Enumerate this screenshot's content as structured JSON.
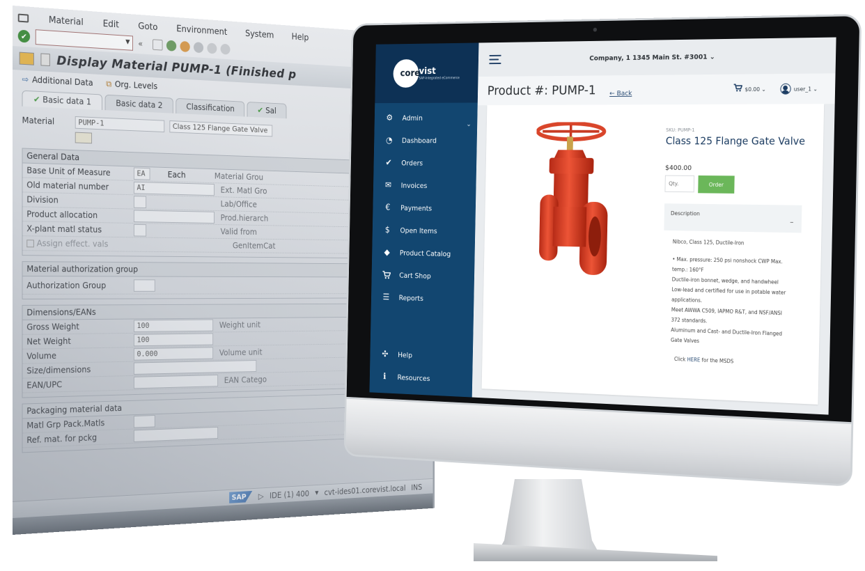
{
  "sap": {
    "menu": [
      "Material",
      "Edit",
      "Goto",
      "Environment",
      "System",
      "Help"
    ],
    "command_field": "",
    "title": "Display Material PUMP-1 (Finished p",
    "app_toolbar": [
      "Additional Data",
      "Org. Levels"
    ],
    "tabs": [
      "Basic data 1",
      "Basic data 2",
      "Classification",
      "Sal"
    ],
    "material_label": "Material",
    "material_value": "PUMP-1",
    "material_description": "Class 125 Flange Gate Valve",
    "general_data": {
      "title": "General Data",
      "rows": [
        {
          "label": "Base Unit of Measure",
          "value": "EA",
          "extra": "Each",
          "side": "Material Grou"
        },
        {
          "label": "Old material number",
          "value": "AI",
          "extra": "",
          "side": "Ext. Matl Gro"
        },
        {
          "label": "Division",
          "value": "",
          "extra": "",
          "side": "Lab/Office"
        },
        {
          "label": "Product allocation",
          "value": "",
          "extra": "",
          "side": "Prod.hierarch"
        },
        {
          "label": "X-plant matl status",
          "value": "",
          "extra": "",
          "side": "Valid from"
        },
        {
          "label": "Assign effect. vals",
          "value": "",
          "extra": "",
          "side": "GenItemCat"
        }
      ]
    },
    "auth_group": {
      "title": "Material authorization group",
      "rows": [
        {
          "label": "Authorization Group",
          "value": ""
        }
      ]
    },
    "dimensions": {
      "title": "Dimensions/EANs",
      "rows": [
        {
          "label": "Gross Weight",
          "value": "100",
          "side": "Weight unit"
        },
        {
          "label": "Net Weight",
          "value": "100",
          "side": ""
        },
        {
          "label": "Volume",
          "value": "0.000",
          "side": "Volume unit"
        },
        {
          "label": "Size/dimensions",
          "value": "",
          "side": ""
        },
        {
          "label": "EAN/UPC",
          "value": "",
          "side": "EAN Catego"
        }
      ]
    },
    "packaging": {
      "title": "Packaging material data",
      "rows": [
        {
          "label": "Matl Grp Pack.Matls",
          "value": ""
        },
        {
          "label": "Ref. mat. for pckg",
          "value": ""
        }
      ]
    },
    "status": {
      "logo": "SAP",
      "system": "IDE (1) 400",
      "server": "cvt-ides01.corevist.local",
      "mode": "INS"
    }
  },
  "app": {
    "logo": {
      "brand": "corevist",
      "tagline": "SAP-Integrated eCommerce"
    },
    "nav": [
      {
        "label": "Admin",
        "icon": "gear-icon",
        "glyph": "⚙"
      },
      {
        "label": "Dashboard",
        "icon": "pie-chart-icon",
        "glyph": "◔"
      },
      {
        "label": "Orders",
        "icon": "clipboard-check-icon",
        "glyph": "✔"
      },
      {
        "label": "Invoices",
        "icon": "invoice-icon",
        "glyph": "✉"
      },
      {
        "label": "Payments",
        "icon": "payment-icon",
        "glyph": "€"
      },
      {
        "label": "Open Items",
        "icon": "dollar-circle-icon",
        "glyph": "$"
      },
      {
        "label": "Product Catalog",
        "icon": "tag-icon",
        "glyph": "◆"
      },
      {
        "label": "Cart Shop",
        "icon": "cart-icon",
        "glyph": "🛒"
      },
      {
        "label": "Reports",
        "icon": "list-icon",
        "glyph": "☰"
      }
    ],
    "nav_bottom": [
      {
        "label": "Help",
        "icon": "lifebuoy-icon",
        "glyph": "✣"
      },
      {
        "label": "Resources",
        "icon": "info-icon",
        "glyph": "ℹ"
      }
    ],
    "company_selector": "Company, 1 1345 Main St. #3001 ⌄",
    "page_title": "Product #: PUMP-1",
    "back_label": "← Back",
    "cart_total": "$0.00 ⌄",
    "user": "user_1 ⌄",
    "product": {
      "sku": "SKU: PUMP-1",
      "name": "Class 125 Flange Gate Valve",
      "price": "$400.00",
      "qty_placeholder": "Qty.",
      "order_label": "Order",
      "description_label": "Description",
      "description_toggle": "–",
      "summary": "Nibco, Class 125, Ductile-Iron",
      "bullets": [
        "• Max. pressure: 250 psi nonshock CWP Max. temp.: 160°F",
        "Ductile-iron bonnet, wedge, and handwheel",
        "Low-lead and certified for use in potable water applications.",
        "Meet AWWA C509, IAPMO R&T, and NSF/ANSI 372 standards.",
        "Aluminum and Cast- and Ductile-Iron Flanged Gate Valves"
      ],
      "msds_prefix": "Click ",
      "msds_link": "HERE",
      "msds_suffix": " for the MSDS"
    },
    "colors": {
      "sidebar": "#124670",
      "sidebar_header": "#0d3155",
      "order_button": "#6bb75a",
      "product_title": "#17385e",
      "valve": "#e0432b"
    }
  }
}
